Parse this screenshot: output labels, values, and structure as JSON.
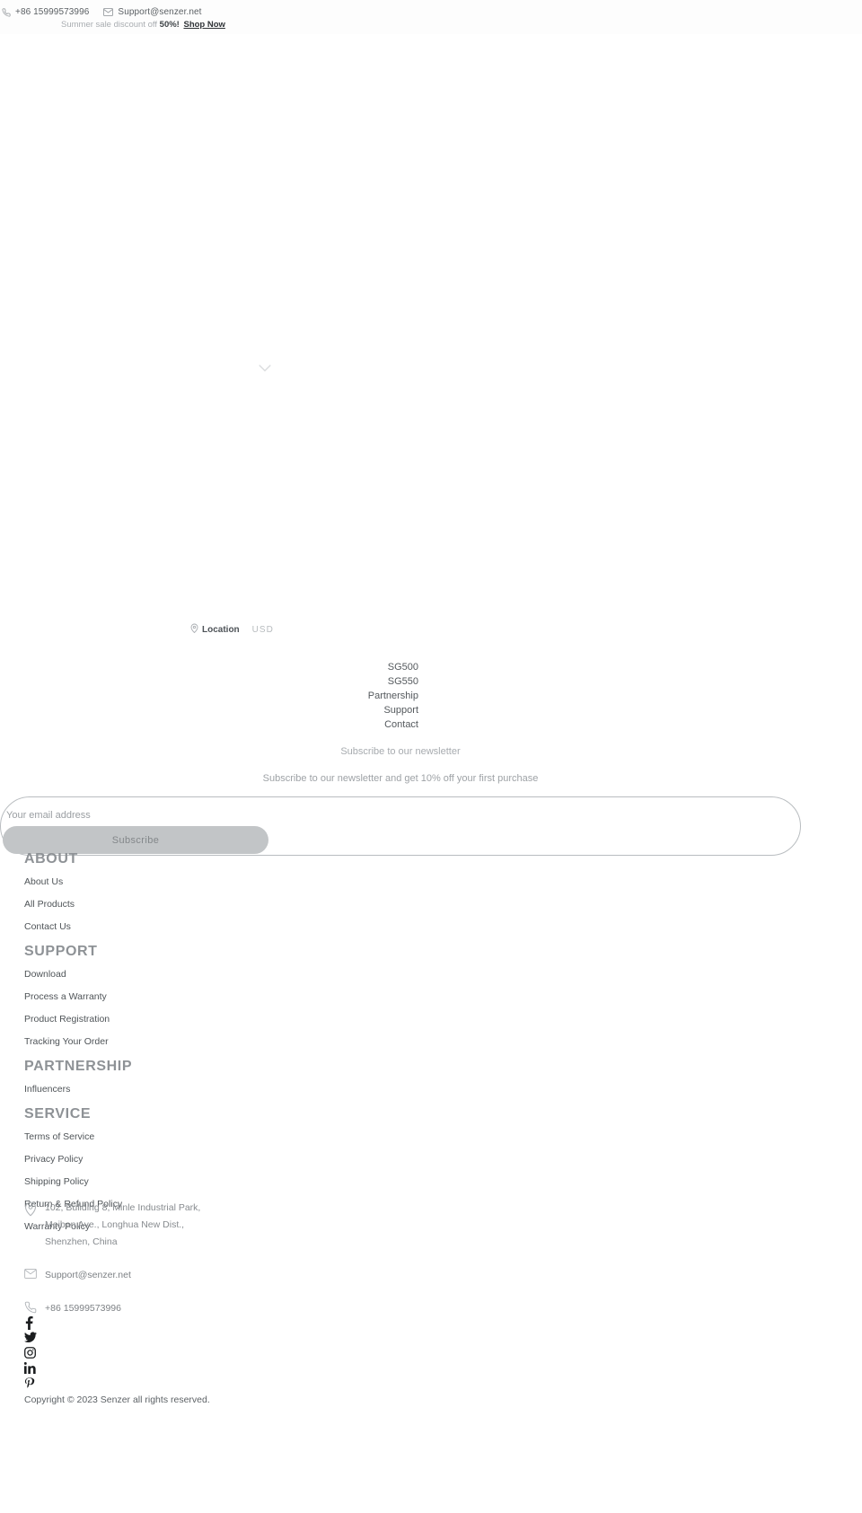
{
  "topbar": {
    "phone": "+86 15999573996",
    "phone_icon": "phone-icon",
    "email": "Support@senzer.net",
    "email_icon": "envelope-icon",
    "promo_prefix": "Summer sale discount off",
    "promo_percent": "50%!",
    "promo_cta": "Shop Now"
  },
  "hero": {
    "scroll_icon": "chevron-down-icon"
  },
  "locale": {
    "location_icon": "map-pin-icon",
    "location_label": "Location",
    "currency": "USD"
  },
  "mainnav": {
    "items": [
      {
        "label": "SG500"
      },
      {
        "label": "SG550"
      },
      {
        "label": "Partnership"
      },
      {
        "label": "Support"
      },
      {
        "label": "Contact"
      }
    ]
  },
  "newsletter": {
    "title": "Subscribe to our newsletter",
    "subtitle": "Subscribe to our newsletter and get 10% off your first purchase",
    "placeholder": "Your email address",
    "input_value": "",
    "button_label": "Subscribe"
  },
  "footer_groups": [
    {
      "heading": "ABOUT",
      "links": [
        {
          "label": "About Us"
        },
        {
          "label": "All Products"
        },
        {
          "label": "Contact Us"
        }
      ]
    },
    {
      "heading": "SUPPORT",
      "links": [
        {
          "label": "Download"
        },
        {
          "label": "Process a Warranty"
        },
        {
          "label": "Product Registration"
        },
        {
          "label": "Tracking Your Order"
        }
      ]
    },
    {
      "heading": "PARTNERSHIP",
      "links": [
        {
          "label": "Influencers"
        }
      ]
    },
    {
      "heading": "SERVICE",
      "links": [
        {
          "label": "Terms of Service"
        },
        {
          "label": "Privacy Policy"
        },
        {
          "label": "Shipping Policy"
        },
        {
          "label": "Return & Refund Policy"
        },
        {
          "label": "Warranty Policy"
        }
      ]
    }
  ],
  "contact": {
    "address_icon": "map-pin-icon",
    "address": "102, Buliding 8, Minle Industrial Park, Meiban Ave., Longhua New Dist., Shenzhen, China",
    "email_icon": "envelope-icon",
    "email": "Support@senzer.net",
    "phone_icon": "phone-icon",
    "phone": "+86 15999573996"
  },
  "social": [
    {
      "name": "facebook-icon",
      "label": "Facebook"
    },
    {
      "name": "twitter-icon",
      "label": "Twitter"
    },
    {
      "name": "instagram-icon",
      "label": "Instagram"
    },
    {
      "name": "linkedin-icon",
      "label": "LinkedIn"
    },
    {
      "name": "pinterest-icon",
      "label": "Pinterest"
    }
  ],
  "copyright": "Copyright © 2023 Senzer all rights reserved.",
  "colors": {
    "page_background": "#ffffff",
    "text_primary": "#4f5458",
    "text_muted": "#a7abaf",
    "heading_gray": "#8e9296",
    "button_gray": "#c2c5c7",
    "border_gray": "#b9bdc0",
    "icon_dark": "#1b1d1f"
  }
}
